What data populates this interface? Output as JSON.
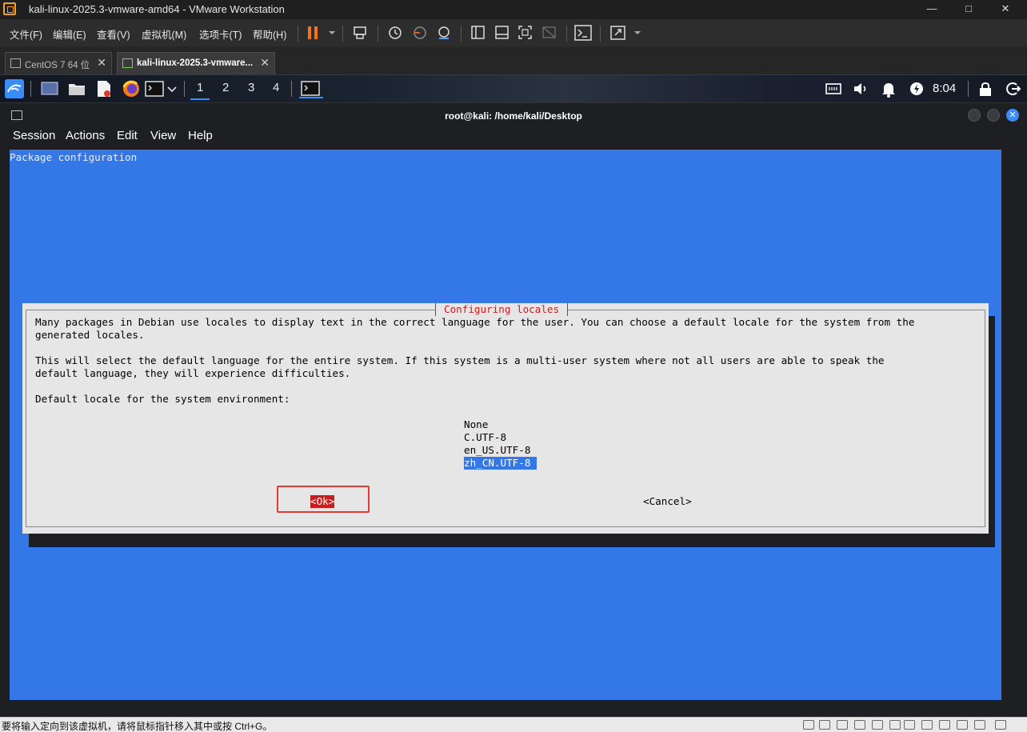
{
  "window": {
    "title": "kali-linux-2025.3-vmware-amd64 - VMware Workstation",
    "minimize": "—",
    "maximize": "□",
    "close": "✕"
  },
  "menubar": {
    "items": [
      "文件(F)",
      "编辑(E)",
      "查看(V)",
      "虚拟机(M)",
      "选项卡(T)",
      "帮助(H)"
    ]
  },
  "tabs": [
    {
      "label": "CentOS 7 64 位",
      "close": "✕"
    },
    {
      "label": "kali-linux-2025.3-vmware...",
      "close": "✕"
    }
  ],
  "kali_panel": {
    "workspaces": [
      "1",
      "2",
      "3",
      "4"
    ],
    "active_workspace": "1",
    "clock": "8:04"
  },
  "terminal": {
    "title": "root@kali: /home/kali/Desktop",
    "menu": [
      "Session",
      "Actions",
      "Edit",
      "View",
      "Help"
    ],
    "close_glyph": "✕"
  },
  "debconf": {
    "backtitle": "Package configuration",
    "dialog_title": "Configuring locales",
    "lines": [
      "Many packages in Debian use locales to display text in the correct language for the user. You can choose a default locale for the system from the",
      "generated locales.",
      "",
      "This will select the default language for the entire system. If this system is a multi-user system where not all users are able to speak the",
      "default language, they will experience difficulties.",
      "",
      "Default locale for the system environment:"
    ],
    "options": [
      "None",
      "C.UTF-8",
      "en_US.UTF-8",
      "zh_CN.UTF-8"
    ],
    "selected_option": "zh_CN.UTF-8",
    "ok_label": "<Ok>",
    "cancel_label": "<Cancel>"
  },
  "statusbar": {
    "text": "要将输入定向到该虚拟机，请将鼠标指针移入其中或按 Ctrl+G。"
  },
  "colors": {
    "terminal_bg": "#3478e8",
    "dialog_bg": "#e6e6e6",
    "dialog_title": "#c81e1e",
    "ok_highlight": "#c81e1e",
    "annotation_box": "#e53935",
    "kali_accent": "#3b8df5",
    "vmware_pause": "#f4741a"
  }
}
